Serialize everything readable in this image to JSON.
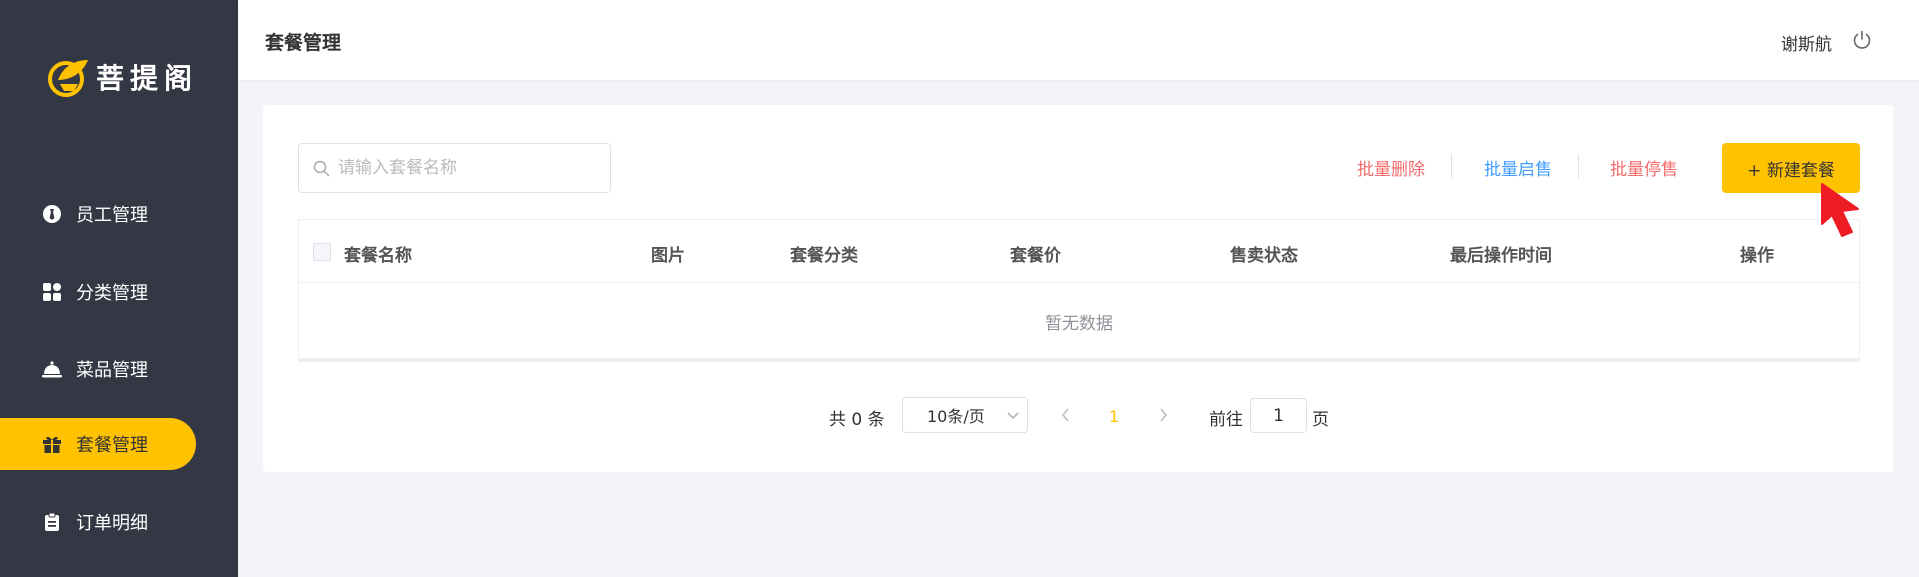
{
  "app": {
    "logo_text": "菩提阁",
    "brand_color": "#ffc200",
    "sidebar_color": "#343744"
  },
  "sidebar": {
    "items": [
      {
        "label": "员工管理",
        "icon": "employee-icon",
        "active": false
      },
      {
        "label": "分类管理",
        "icon": "category-grid-icon",
        "active": false
      },
      {
        "label": "菜品管理",
        "icon": "dish-cloche-icon",
        "active": false
      },
      {
        "label": "套餐管理",
        "icon": "gift-icon",
        "active": true
      },
      {
        "label": "订单明细",
        "icon": "clipboard-icon",
        "active": false
      }
    ]
  },
  "header": {
    "title": "套餐管理",
    "user_name": "谢斯航",
    "logout_icon": "power-icon"
  },
  "toolbar": {
    "search_placeholder": "请输入套餐名称",
    "batch_delete": "批量删除",
    "batch_enable": "批量启售",
    "batch_disable": "批量停售",
    "new_button": "+ 新建套餐",
    "danger_color": "#f56c6c",
    "primary_color": "#419eff"
  },
  "table": {
    "columns": [
      "套餐名称",
      "图片",
      "套餐分类",
      "套餐价",
      "售卖状态",
      "最后操作时间",
      "操作"
    ],
    "rows": [],
    "empty_text": "暂无数据"
  },
  "pagination": {
    "total_text": "共 0 条",
    "page_size": "10条/页",
    "current_page": "1",
    "goto_label": "前往",
    "goto_value": "1",
    "goto_suffix": "页"
  }
}
